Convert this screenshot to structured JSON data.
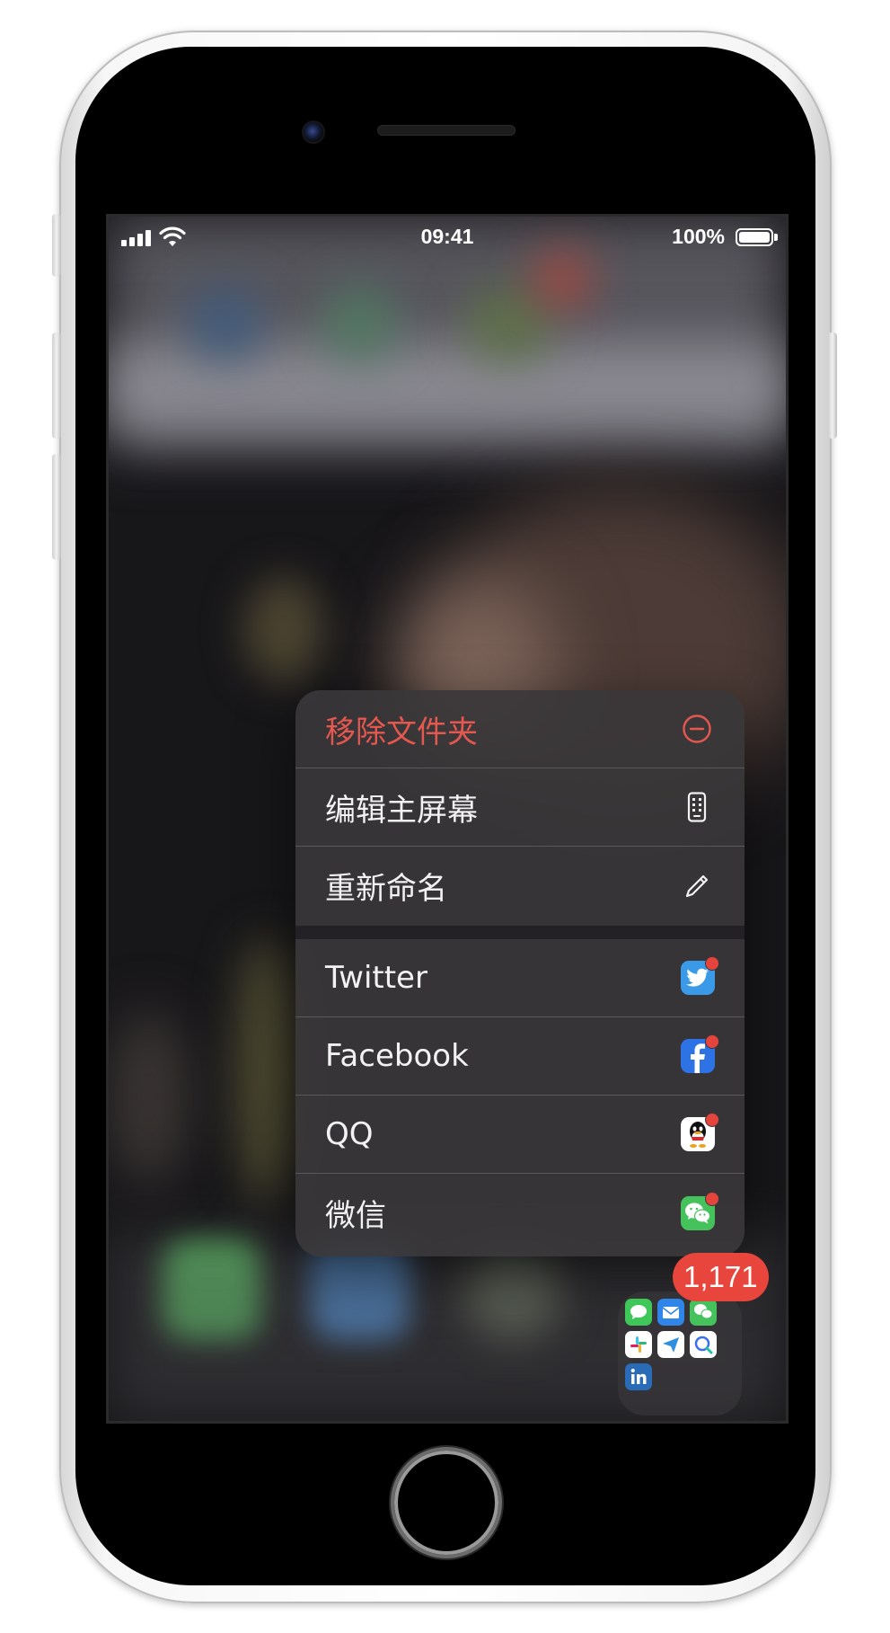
{
  "status_bar": {
    "time": "09:41",
    "battery_percent": "100%",
    "signal_bars": 4,
    "wifi": true
  },
  "context_menu": {
    "actions": [
      {
        "label": "移除文件夹",
        "icon": "minus-circle-icon",
        "destructive": true
      },
      {
        "label": "编辑主屏幕",
        "icon": "phone-grid-icon",
        "destructive": false
      },
      {
        "label": "重新命名",
        "icon": "pencil-icon",
        "destructive": false
      }
    ],
    "apps": [
      {
        "label": "Twitter",
        "icon": "twitter-icon",
        "color": "#3a9ae8",
        "has_notification": true
      },
      {
        "label": "Facebook",
        "icon": "facebook-icon",
        "color": "#2d73e6",
        "has_notification": true
      },
      {
        "label": "QQ",
        "icon": "qq-icon",
        "color": "#ffffff",
        "has_notification": true
      },
      {
        "label": "微信",
        "icon": "wechat-icon",
        "color": "#45c25b",
        "has_notification": true
      }
    ]
  },
  "folder": {
    "badge_count": "1,171",
    "apps": [
      {
        "name": "messages-icon",
        "color": "#3fc75a"
      },
      {
        "name": "mail-icon",
        "color": "#2f86e8"
      },
      {
        "name": "wechat-icon",
        "color": "#45c25b"
      },
      {
        "name": "slack-icon",
        "color": "#ffffff"
      },
      {
        "name": "testflight-icon",
        "color": "#ffffff"
      },
      {
        "name": "quark-icon",
        "color": "#ffffff"
      },
      {
        "name": "linkedin-icon",
        "color": "#2a6bb8"
      }
    ]
  },
  "colors": {
    "destructive": "#e5584f",
    "badge": "#e8463d",
    "menu_background": "#3a373a"
  }
}
